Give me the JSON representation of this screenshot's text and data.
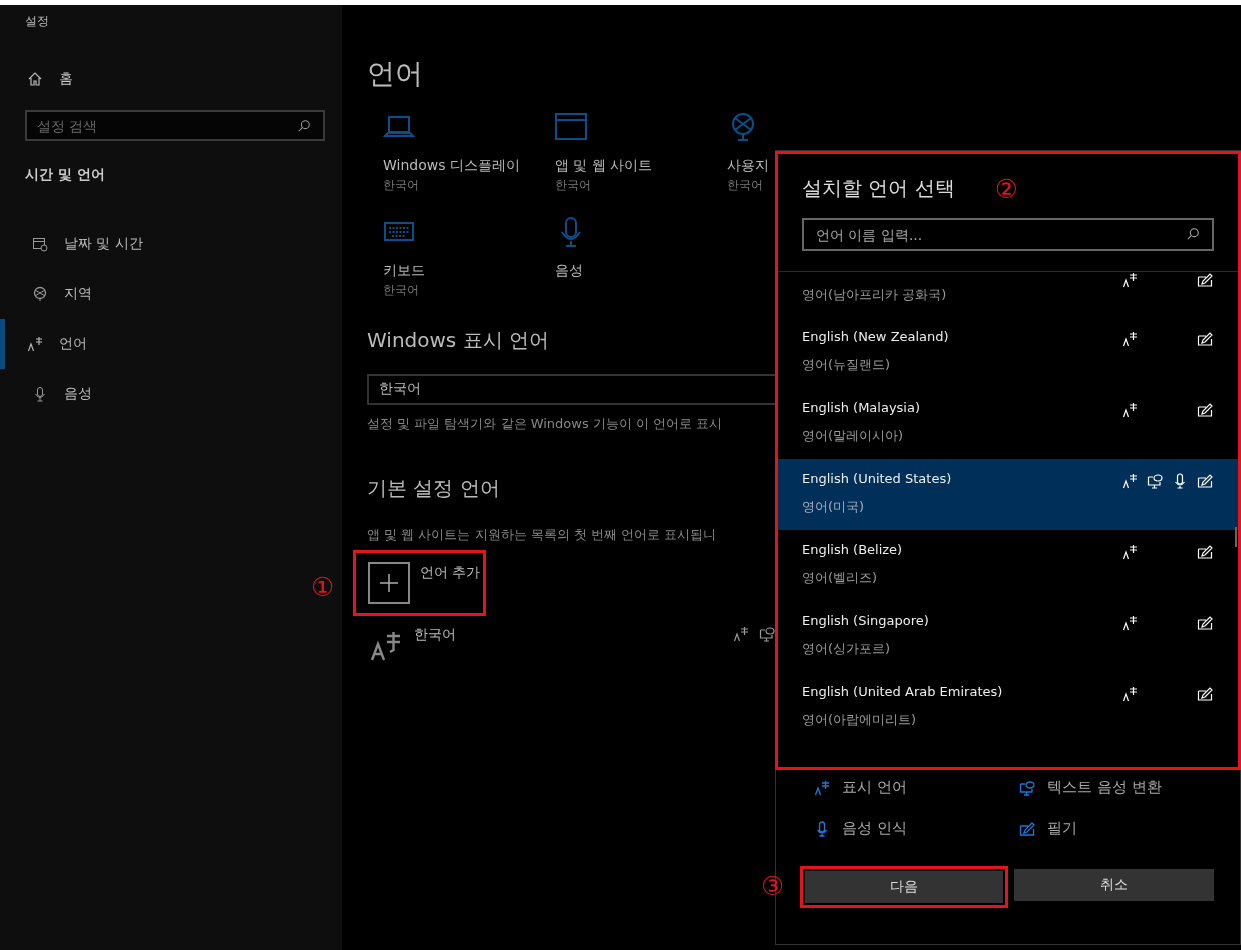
{
  "sidebar": {
    "app_title": "설정",
    "home": "홈",
    "search": {
      "placeholder": "설정 검색"
    },
    "section": "시간 및 언어",
    "items": [
      {
        "label": "날짜 및 시간",
        "selected": false
      },
      {
        "label": "지역",
        "selected": false
      },
      {
        "label": "언어",
        "selected": true
      },
      {
        "label": "음성",
        "selected": false
      }
    ]
  },
  "main": {
    "title": "언어",
    "tiles": [
      {
        "label": "Windows 디스플레이",
        "value": "한국어"
      },
      {
        "label": "앱 및 웹 사이트",
        "value": "한국어"
      },
      {
        "label": "사용지",
        "value": "한국어"
      },
      {
        "label": "키보드",
        "value": "한국어"
      },
      {
        "label": "음성"
      }
    ],
    "display_language": {
      "heading": "Windows 표시 언어",
      "value": "한국어",
      "description": "설정 및 파일 탐색기와 같은 Windows 기능이 이 언어로 표시"
    },
    "preferred": {
      "heading": "기본 설정 언어",
      "description": "앱 및 웹 사이트는 지원하는 목록의 첫 번째 언어로 표시됩니",
      "add_button": "언어 추가",
      "languages": [
        {
          "name": "한국어",
          "display": true,
          "speech": true
        }
      ]
    }
  },
  "dialog": {
    "title": "설치할 언어 선택",
    "search": {
      "placeholder": "언어 이름 입력..."
    },
    "languages": [
      {
        "native": "영어(남아프리카 공화국)",
        "display": true,
        "speech": false,
        "mic": false,
        "handwriting": true,
        "selected": false
      },
      {
        "name": "English (New Zealand)",
        "native": "영어(뉴질랜드)",
        "display": true,
        "speech": false,
        "mic": false,
        "handwriting": true,
        "selected": false
      },
      {
        "name": "English (Malaysia)",
        "native": "영어(말레이시아)",
        "display": true,
        "speech": false,
        "mic": false,
        "handwriting": true,
        "selected": false
      },
      {
        "name": "English (United States)",
        "native": "영어(미국)",
        "display": true,
        "speech": true,
        "mic": true,
        "handwriting": true,
        "selected": true
      },
      {
        "name": "English (Belize)",
        "native": "영어(벨리즈)",
        "display": true,
        "speech": false,
        "mic": false,
        "handwriting": true,
        "selected": false
      },
      {
        "name": "English (Singapore)",
        "native": "영어(싱가포르)",
        "display": true,
        "speech": false,
        "mic": false,
        "handwriting": true,
        "selected": false
      },
      {
        "name": "English (United Arab Emirates)",
        "native": "영어(아랍에미리트)",
        "display": true,
        "speech": false,
        "mic": false,
        "handwriting": true,
        "selected": false
      }
    ],
    "legend": [
      {
        "kind": "display",
        "label": "표시 언어"
      },
      {
        "kind": "speech",
        "label": "텍스트 음성 변환"
      },
      {
        "kind": "mic",
        "label": "음성 인식"
      },
      {
        "kind": "handwriting",
        "label": "필기"
      }
    ],
    "buttons": [
      {
        "kind": "primary",
        "label": "다음"
      },
      {
        "kind": "secondary",
        "label": "취소"
      }
    ]
  },
  "annotations": [
    "①",
    "②",
    "③"
  ]
}
